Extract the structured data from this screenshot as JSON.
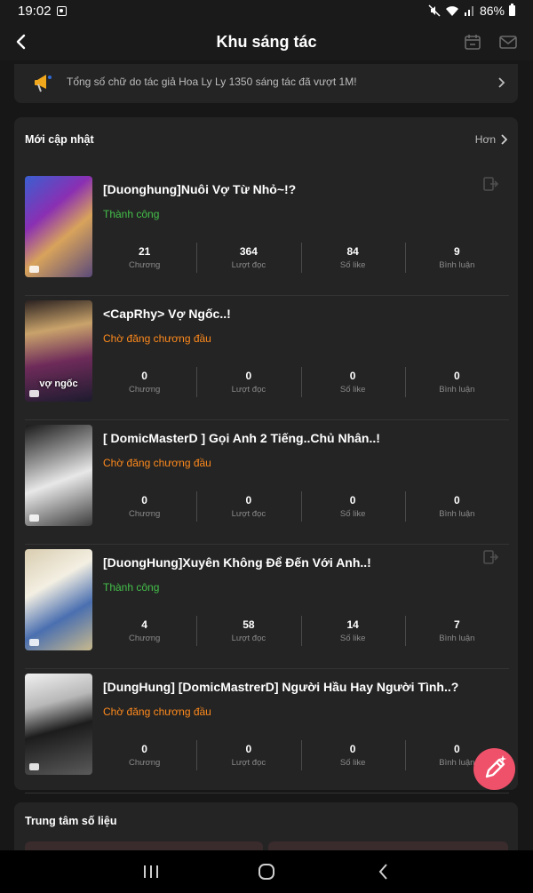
{
  "status_bar": {
    "time": "19:02",
    "battery": "86%"
  },
  "header": {
    "title": "Khu sáng tác"
  },
  "notice": {
    "text": "Tổng số chữ do tác giả Hoa Ly Ly 1350 sáng tác đã vượt 1M!"
  },
  "recent": {
    "title": "Mới cập nhật",
    "more": "Hơn",
    "stat_labels": [
      "Chương",
      "Lượt đọc",
      "Số like",
      "Bình luận"
    ],
    "stories": [
      {
        "title": "[Duonghung]Nuôi Vợ Từ Nhỏ~!?",
        "status": "Thành công",
        "status_type": "success",
        "chapters": "21",
        "reads": "364",
        "likes": "84",
        "comments": "9",
        "cover_text": ""
      },
      {
        "title": "<CapRhy> Vợ Ngốc..!",
        "status": "Chờ đăng chương đầu",
        "status_type": "pending",
        "chapters": "0",
        "reads": "0",
        "likes": "0",
        "comments": "0",
        "cover_text": "vợ ngốc"
      },
      {
        "title": "[ DomicMasterD ] Gọi Anh 2 Tiếng..Chủ Nhân..!",
        "status": "Chờ đăng chương đầu",
        "status_type": "pending",
        "chapters": "0",
        "reads": "0",
        "likes": "0",
        "comments": "0",
        "cover_text": ""
      },
      {
        "title": "[DuongHung]Xuyên Không Để Đến Với Anh..!",
        "status": "Thành công",
        "status_type": "success",
        "chapters": "4",
        "reads": "58",
        "likes": "14",
        "comments": "7",
        "cover_text": ""
      },
      {
        "title": "[DungHung] [DomicMastrerD] Người Hầu Hay Người Tình..?",
        "status": "Chờ đăng chương đầu",
        "status_type": "pending",
        "chapters": "0",
        "reads": "0",
        "likes": "0",
        "comments": "0",
        "cover_text": ""
      }
    ]
  },
  "data_center": {
    "title": "Trung tâm số liệu"
  },
  "colors": {
    "success": "#44c04a",
    "pending": "#ff8a1c",
    "fab": "#f0516a"
  }
}
